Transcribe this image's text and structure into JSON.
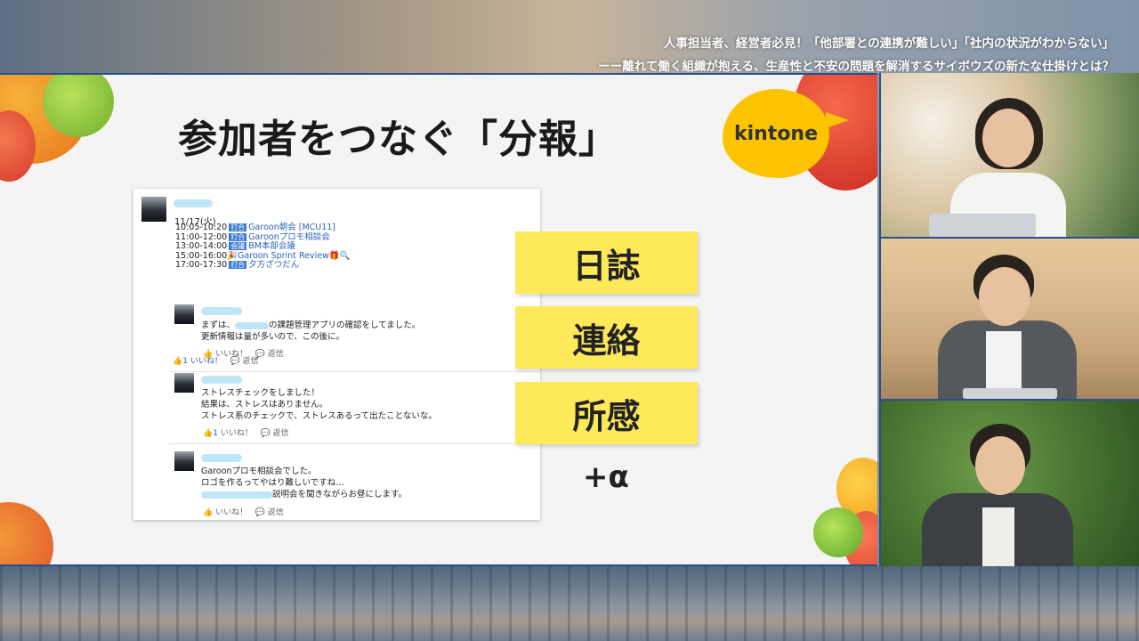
{
  "headline": {
    "line1": "人事担当者、経営者必見！「他部署との連携が難しい」「社内の状況がわからない」",
    "line2": "ーー離れて働く組織が抱える、生産性と不安の問題を解消するサイボウズの新たな仕掛けとは？"
  },
  "slide": {
    "title": "参加者をつなぐ「分報」",
    "brand": "kintone",
    "labels": [
      "日誌",
      "連絡",
      "所感"
    ],
    "plus": "+α"
  },
  "feed": {
    "post": {
      "date": "11/17(火)",
      "schedule": [
        {
          "time": "10:05-10:20",
          "tag": "打合",
          "text": "Garoon朝会 [MCU11]"
        },
        {
          "time": "11:00-12:00",
          "tag": "打合",
          "text": "Garoonプロモ相談会"
        },
        {
          "time": "13:00-14:00",
          "tag": "会議",
          "text": "BM本部会議"
        },
        {
          "time": "15:00-16:00",
          "tag": "🎉",
          "text": "Garoon Sprint Review🎁🔍"
        },
        {
          "time": "17:00-17:30",
          "tag": "打合",
          "text": "夕方ざつだん"
        }
      ],
      "like_count": "1",
      "like_label": "いいね！",
      "reply_label": "返信"
    },
    "comments": [
      {
        "lines": [
          "まずは、",
          "の課題管理アプリの確認をしてました。",
          "更新情報は量が多いので、この後に。"
        ],
        "like_count": "",
        "like_label": "いいね！",
        "reply_label": "返信"
      },
      {
        "lines": [
          "ストレスチェックをしました！",
          "結果は、ストレスはありません。",
          "ストレス系のチェックで、ストレスあるって出たことないな。"
        ],
        "like_count": "1",
        "like_label": "いいね！",
        "reply_label": "返信"
      },
      {
        "lines": [
          "Garoonプロモ相談会でした。",
          "ロゴを作るってやはり難しいですね…",
          "説明会を聞きながらお昼にします。"
        ],
        "like_count": "",
        "like_label": "いいね！",
        "reply_label": "返信"
      }
    ]
  },
  "colors": {
    "accent_yellow": "#fde959",
    "kintone_yellow": "#fcc400",
    "link_blue": "#2a62b6",
    "frame_blue": "#2a4f8f"
  },
  "icons": [
    "thumbs-up-icon",
    "comment-icon"
  ]
}
